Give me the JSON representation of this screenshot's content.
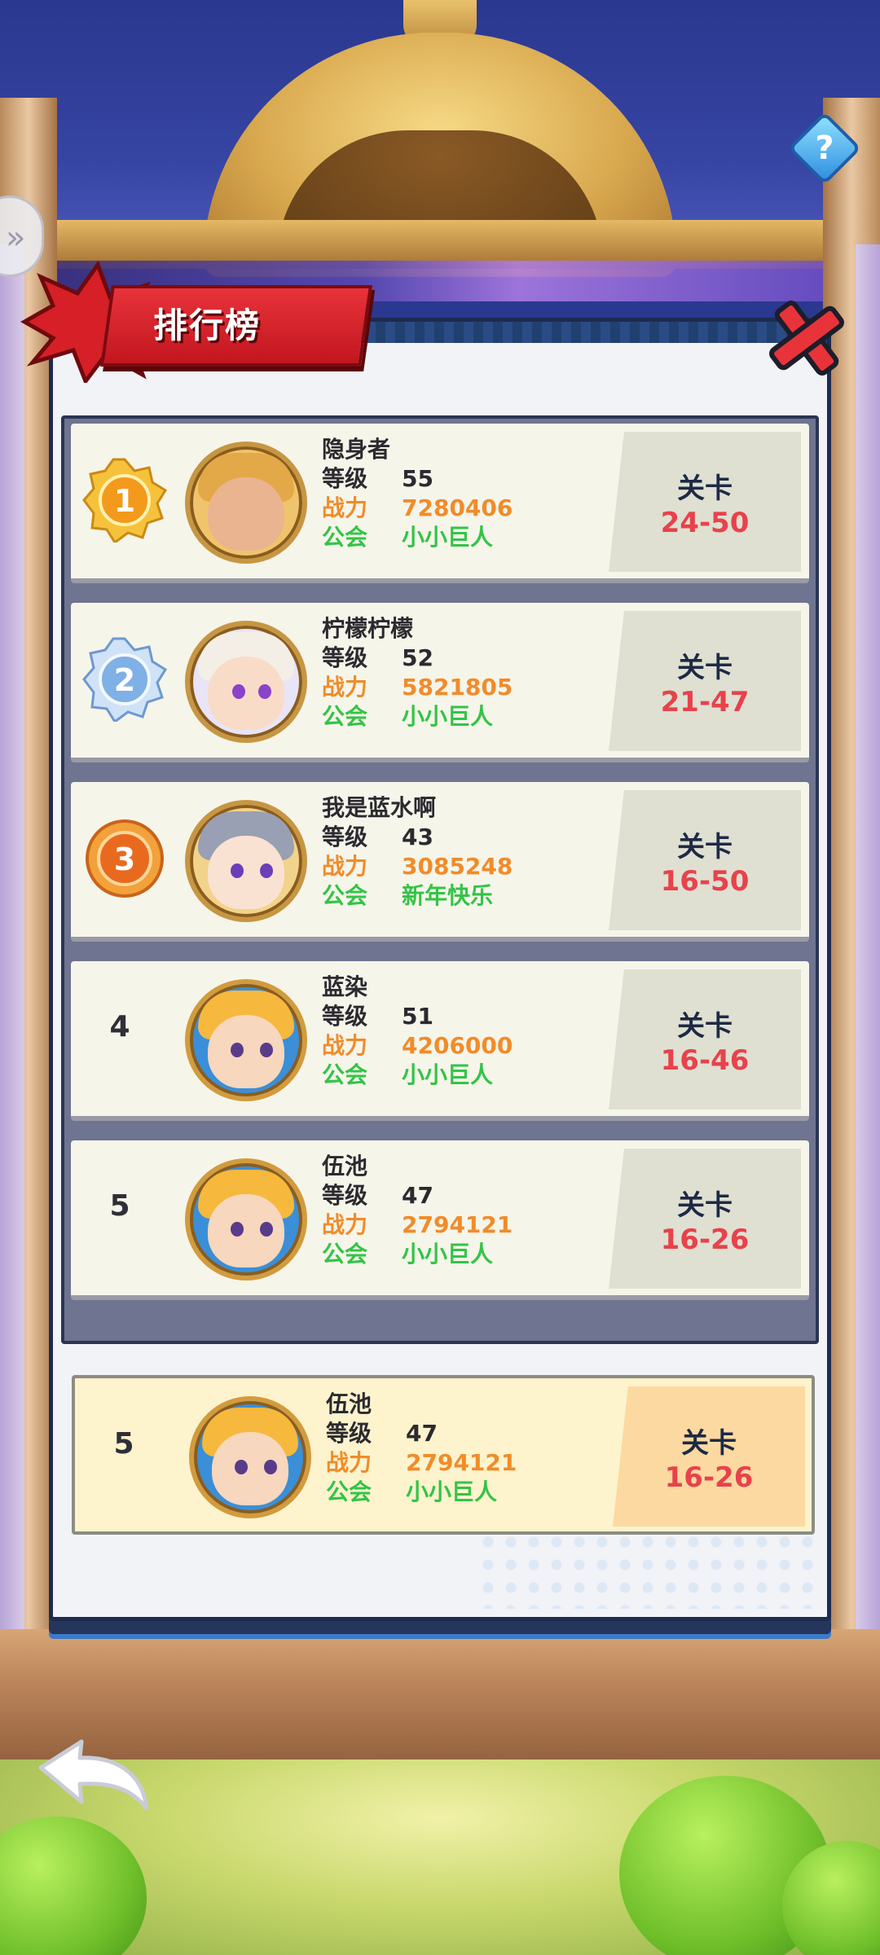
{
  "title": "排行榜",
  "labels": {
    "level": "等级",
    "power": "战力",
    "guild": "公会",
    "stage": "关卡"
  },
  "leaderboard": [
    {
      "rank": "1",
      "name": "隐身者",
      "level": "55",
      "power": "7280406",
      "guild": "小小巨人",
      "stage": "24-50",
      "avatar": "lion-hood-warrior"
    },
    {
      "rank": "2",
      "name": "柠檬柠檬",
      "level": "52",
      "power": "5821805",
      "guild": "小小巨人",
      "stage": "21-47",
      "avatar": "polar-bear-hood-girl"
    },
    {
      "rank": "3",
      "name": "我是蓝水啊",
      "level": "43",
      "power": "3085248",
      "guild": "新年快乐",
      "stage": "16-50",
      "avatar": "crowned-knight"
    },
    {
      "rank": "4",
      "name": "蓝染",
      "level": "51",
      "power": "4206000",
      "guild": "小小巨人",
      "stage": "16-46",
      "avatar": "blonde-boy"
    },
    {
      "rank": "5",
      "name": "伍池",
      "level": "47",
      "power": "2794121",
      "guild": "小小巨人",
      "stage": "16-26",
      "avatar": "blonde-boy"
    }
  ],
  "my_rank": {
    "rank": "5",
    "name": "伍池",
    "level": "47",
    "power": "2794121",
    "guild": "小小巨人",
    "stage": "16-26",
    "avatar": "blonde-boy"
  },
  "colors": {
    "level": "#2b2a2f",
    "power": "#f08c2a",
    "guild": "#33c447",
    "stage_value": "#e8424b",
    "title_ribbon": "#c2161f"
  },
  "icons": {
    "help": "question-icon",
    "side": "double-chevron-icon",
    "close": "close-icon",
    "back": "back-arrow-icon"
  }
}
